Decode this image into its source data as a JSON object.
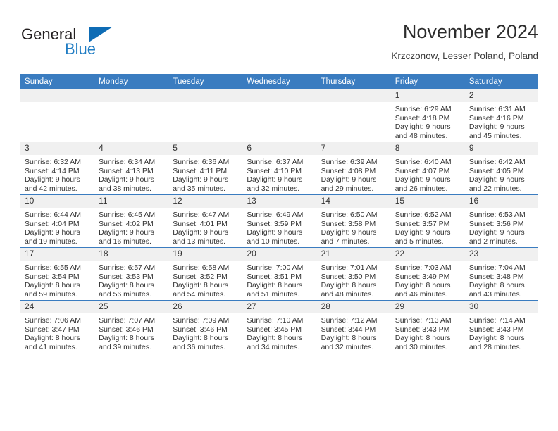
{
  "brand": {
    "name_part1": "General",
    "name_part2": "Blue",
    "triangle_color": "#0e6cb5",
    "blue_text_color": "#1f7cc3"
  },
  "header": {
    "title": "November 2024",
    "subtitle": "Krzczonow, Lesser Poland, Poland"
  },
  "theme": {
    "header_blue": "#3a7cc0",
    "daynum_band": "#f0f0f0",
    "text": "#333333"
  },
  "weekday_headers": [
    "Sunday",
    "Monday",
    "Tuesday",
    "Wednesday",
    "Thursday",
    "Friday",
    "Saturday"
  ],
  "weeks": [
    [
      {
        "day": "",
        "empty": true,
        "sunrise": "",
        "sunset": "",
        "daylight_line1": "",
        "daylight_line2": ""
      },
      {
        "day": "",
        "empty": true,
        "sunrise": "",
        "sunset": "",
        "daylight_line1": "",
        "daylight_line2": ""
      },
      {
        "day": "",
        "empty": true,
        "sunrise": "",
        "sunset": "",
        "daylight_line1": "",
        "daylight_line2": ""
      },
      {
        "day": "",
        "empty": true,
        "sunrise": "",
        "sunset": "",
        "daylight_line1": "",
        "daylight_line2": ""
      },
      {
        "day": "",
        "empty": true,
        "sunrise": "",
        "sunset": "",
        "daylight_line1": "",
        "daylight_line2": ""
      },
      {
        "day": "1",
        "empty": false,
        "sunrise": "Sunrise: 6:29 AM",
        "sunset": "Sunset: 4:18 PM",
        "daylight_line1": "Daylight: 9 hours",
        "daylight_line2": "and 48 minutes."
      },
      {
        "day": "2",
        "empty": false,
        "sunrise": "Sunrise: 6:31 AM",
        "sunset": "Sunset: 4:16 PM",
        "daylight_line1": "Daylight: 9 hours",
        "daylight_line2": "and 45 minutes."
      }
    ],
    [
      {
        "day": "3",
        "empty": false,
        "sunrise": "Sunrise: 6:32 AM",
        "sunset": "Sunset: 4:14 PM",
        "daylight_line1": "Daylight: 9 hours",
        "daylight_line2": "and 42 minutes."
      },
      {
        "day": "4",
        "empty": false,
        "sunrise": "Sunrise: 6:34 AM",
        "sunset": "Sunset: 4:13 PM",
        "daylight_line1": "Daylight: 9 hours",
        "daylight_line2": "and 38 minutes."
      },
      {
        "day": "5",
        "empty": false,
        "sunrise": "Sunrise: 6:36 AM",
        "sunset": "Sunset: 4:11 PM",
        "daylight_line1": "Daylight: 9 hours",
        "daylight_line2": "and 35 minutes."
      },
      {
        "day": "6",
        "empty": false,
        "sunrise": "Sunrise: 6:37 AM",
        "sunset": "Sunset: 4:10 PM",
        "daylight_line1": "Daylight: 9 hours",
        "daylight_line2": "and 32 minutes."
      },
      {
        "day": "7",
        "empty": false,
        "sunrise": "Sunrise: 6:39 AM",
        "sunset": "Sunset: 4:08 PM",
        "daylight_line1": "Daylight: 9 hours",
        "daylight_line2": "and 29 minutes."
      },
      {
        "day": "8",
        "empty": false,
        "sunrise": "Sunrise: 6:40 AM",
        "sunset": "Sunset: 4:07 PM",
        "daylight_line1": "Daylight: 9 hours",
        "daylight_line2": "and 26 minutes."
      },
      {
        "day": "9",
        "empty": false,
        "sunrise": "Sunrise: 6:42 AM",
        "sunset": "Sunset: 4:05 PM",
        "daylight_line1": "Daylight: 9 hours",
        "daylight_line2": "and 22 minutes."
      }
    ],
    [
      {
        "day": "10",
        "empty": false,
        "sunrise": "Sunrise: 6:44 AM",
        "sunset": "Sunset: 4:04 PM",
        "daylight_line1": "Daylight: 9 hours",
        "daylight_line2": "and 19 minutes."
      },
      {
        "day": "11",
        "empty": false,
        "sunrise": "Sunrise: 6:45 AM",
        "sunset": "Sunset: 4:02 PM",
        "daylight_line1": "Daylight: 9 hours",
        "daylight_line2": "and 16 minutes."
      },
      {
        "day": "12",
        "empty": false,
        "sunrise": "Sunrise: 6:47 AM",
        "sunset": "Sunset: 4:01 PM",
        "daylight_line1": "Daylight: 9 hours",
        "daylight_line2": "and 13 minutes."
      },
      {
        "day": "13",
        "empty": false,
        "sunrise": "Sunrise: 6:49 AM",
        "sunset": "Sunset: 3:59 PM",
        "daylight_line1": "Daylight: 9 hours",
        "daylight_line2": "and 10 minutes."
      },
      {
        "day": "14",
        "empty": false,
        "sunrise": "Sunrise: 6:50 AM",
        "sunset": "Sunset: 3:58 PM",
        "daylight_line1": "Daylight: 9 hours",
        "daylight_line2": "and 7 minutes."
      },
      {
        "day": "15",
        "empty": false,
        "sunrise": "Sunrise: 6:52 AM",
        "sunset": "Sunset: 3:57 PM",
        "daylight_line1": "Daylight: 9 hours",
        "daylight_line2": "and 5 minutes."
      },
      {
        "day": "16",
        "empty": false,
        "sunrise": "Sunrise: 6:53 AM",
        "sunset": "Sunset: 3:56 PM",
        "daylight_line1": "Daylight: 9 hours",
        "daylight_line2": "and 2 minutes."
      }
    ],
    [
      {
        "day": "17",
        "empty": false,
        "sunrise": "Sunrise: 6:55 AM",
        "sunset": "Sunset: 3:54 PM",
        "daylight_line1": "Daylight: 8 hours",
        "daylight_line2": "and 59 minutes."
      },
      {
        "day": "18",
        "empty": false,
        "sunrise": "Sunrise: 6:57 AM",
        "sunset": "Sunset: 3:53 PM",
        "daylight_line1": "Daylight: 8 hours",
        "daylight_line2": "and 56 minutes."
      },
      {
        "day": "19",
        "empty": false,
        "sunrise": "Sunrise: 6:58 AM",
        "sunset": "Sunset: 3:52 PM",
        "daylight_line1": "Daylight: 8 hours",
        "daylight_line2": "and 54 minutes."
      },
      {
        "day": "20",
        "empty": false,
        "sunrise": "Sunrise: 7:00 AM",
        "sunset": "Sunset: 3:51 PM",
        "daylight_line1": "Daylight: 8 hours",
        "daylight_line2": "and 51 minutes."
      },
      {
        "day": "21",
        "empty": false,
        "sunrise": "Sunrise: 7:01 AM",
        "sunset": "Sunset: 3:50 PM",
        "daylight_line1": "Daylight: 8 hours",
        "daylight_line2": "and 48 minutes."
      },
      {
        "day": "22",
        "empty": false,
        "sunrise": "Sunrise: 7:03 AM",
        "sunset": "Sunset: 3:49 PM",
        "daylight_line1": "Daylight: 8 hours",
        "daylight_line2": "and 46 minutes."
      },
      {
        "day": "23",
        "empty": false,
        "sunrise": "Sunrise: 7:04 AM",
        "sunset": "Sunset: 3:48 PM",
        "daylight_line1": "Daylight: 8 hours",
        "daylight_line2": "and 43 minutes."
      }
    ],
    [
      {
        "day": "24",
        "empty": false,
        "sunrise": "Sunrise: 7:06 AM",
        "sunset": "Sunset: 3:47 PM",
        "daylight_line1": "Daylight: 8 hours",
        "daylight_line2": "and 41 minutes."
      },
      {
        "day": "25",
        "empty": false,
        "sunrise": "Sunrise: 7:07 AM",
        "sunset": "Sunset: 3:46 PM",
        "daylight_line1": "Daylight: 8 hours",
        "daylight_line2": "and 39 minutes."
      },
      {
        "day": "26",
        "empty": false,
        "sunrise": "Sunrise: 7:09 AM",
        "sunset": "Sunset: 3:46 PM",
        "daylight_line1": "Daylight: 8 hours",
        "daylight_line2": "and 36 minutes."
      },
      {
        "day": "27",
        "empty": false,
        "sunrise": "Sunrise: 7:10 AM",
        "sunset": "Sunset: 3:45 PM",
        "daylight_line1": "Daylight: 8 hours",
        "daylight_line2": "and 34 minutes."
      },
      {
        "day": "28",
        "empty": false,
        "sunrise": "Sunrise: 7:12 AM",
        "sunset": "Sunset: 3:44 PM",
        "daylight_line1": "Daylight: 8 hours",
        "daylight_line2": "and 32 minutes."
      },
      {
        "day": "29",
        "empty": false,
        "sunrise": "Sunrise: 7:13 AM",
        "sunset": "Sunset: 3:43 PM",
        "daylight_line1": "Daylight: 8 hours",
        "daylight_line2": "and 30 minutes."
      },
      {
        "day": "30",
        "empty": false,
        "sunrise": "Sunrise: 7:14 AM",
        "sunset": "Sunset: 3:43 PM",
        "daylight_line1": "Daylight: 8 hours",
        "daylight_line2": "and 28 minutes."
      }
    ]
  ]
}
